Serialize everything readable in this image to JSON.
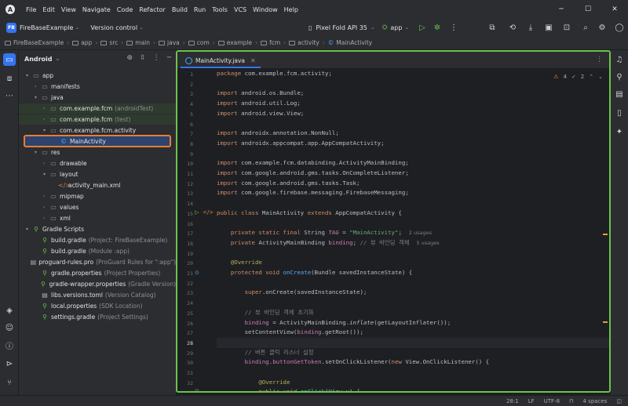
{
  "menu": [
    "File",
    "Edit",
    "View",
    "Navigate",
    "Code",
    "Refactor",
    "Build",
    "Run",
    "Tools",
    "VCS",
    "Window",
    "Help"
  ],
  "toolbar": {
    "project_badge": "FB",
    "project_name": "FireBaseExample",
    "version_control": "Version control",
    "device": "Pixel Fold API 35",
    "run_config": "app"
  },
  "breadcrumb": [
    "FireBaseExample",
    "app",
    "src",
    "main",
    "java",
    "com",
    "example",
    "fcm",
    "activity",
    "MainActivity"
  ],
  "project_panel": {
    "view_mode": "Android",
    "tree": [
      {
        "label": "app",
        "hint": "",
        "icon": "folder",
        "arrow": "▾",
        "indent": 0
      },
      {
        "label": "manifests",
        "hint": "",
        "icon": "folder",
        "arrow": "›",
        "indent": 1
      },
      {
        "label": "java",
        "hint": "",
        "icon": "folder",
        "arrow": "▾",
        "indent": 1
      },
      {
        "label": "com.example.fcm",
        "hint": "(androidTest)",
        "icon": "package",
        "arrow": "›",
        "indent": 2
      },
      {
        "label": "com.example.fcm",
        "hint": "(test)",
        "icon": "package",
        "arrow": "›",
        "indent": 2
      },
      {
        "label": "com.example.fcm.activity",
        "hint": "",
        "icon": "package",
        "arrow": "▾",
        "indent": 2
      },
      {
        "label": "MainActivity",
        "hint": "",
        "icon": "class",
        "arrow": "",
        "indent": 3
      },
      {
        "label": "res",
        "hint": "",
        "icon": "folder",
        "arrow": "▾",
        "indent": 1
      },
      {
        "label": "drawable",
        "hint": "",
        "icon": "folder",
        "arrow": "›",
        "indent": 2
      },
      {
        "label": "layout",
        "hint": "",
        "icon": "folder",
        "arrow": "▾",
        "indent": 2
      },
      {
        "label": "activity_main.xml",
        "hint": "",
        "icon": "xml",
        "arrow": "",
        "indent": 3
      },
      {
        "label": "mipmap",
        "hint": "",
        "icon": "folder",
        "arrow": "›",
        "indent": 2
      },
      {
        "label": "values",
        "hint": "",
        "icon": "folder",
        "arrow": "›",
        "indent": 2
      },
      {
        "label": "xml",
        "hint": "",
        "icon": "folder",
        "arrow": "›",
        "indent": 2
      },
      {
        "label": "Gradle Scripts",
        "hint": "",
        "icon": "gradle",
        "arrow": "▾",
        "indent": 0
      },
      {
        "label": "build.gradle",
        "hint": "(Project: FireBaseExample)",
        "icon": "gradle",
        "arrow": "",
        "indent": 1
      },
      {
        "label": "build.gradle",
        "hint": "(Module :app)",
        "icon": "gradle",
        "arrow": "",
        "indent": 1
      },
      {
        "label": "proguard-rules.pro",
        "hint": "(ProGuard Rules for \":app\")",
        "icon": "file",
        "arrow": "",
        "indent": 1
      },
      {
        "label": "gradle.properties",
        "hint": "(Project Properties)",
        "icon": "gradle",
        "arrow": "",
        "indent": 1
      },
      {
        "label": "gradle-wrapper.properties",
        "hint": "(Gradle Version)",
        "icon": "gradle",
        "arrow": "",
        "indent": 1
      },
      {
        "label": "libs.versions.toml",
        "hint": "(Version Catalog)",
        "icon": "file",
        "arrow": "",
        "indent": 1
      },
      {
        "label": "local.properties",
        "hint": "(SDK Location)",
        "icon": "gradle",
        "arrow": "",
        "indent": 1
      },
      {
        "label": "settings.gradle",
        "hint": "(Project Settings)",
        "icon": "gradle",
        "arrow": "",
        "indent": 1
      }
    ]
  },
  "editor": {
    "tab": "MainActivity.java",
    "inspections": {
      "warnings": "4",
      "ok": "2"
    },
    "line_numbers": [
      "1",
      "2",
      "3",
      "4",
      "5",
      "6",
      "7",
      "8",
      "9",
      "10",
      "11",
      "12",
      "13",
      "14",
      "15",
      "16",
      "17",
      "18",
      "19",
      "20",
      "21",
      "22",
      "23",
      "24",
      "25",
      "26",
      "27",
      "28",
      "29",
      "30",
      "31",
      "32"
    ]
  },
  "status": {
    "position": "28:1",
    "line_sep": "LF",
    "encoding": "UTF-8",
    "indent": "4 spaces"
  }
}
